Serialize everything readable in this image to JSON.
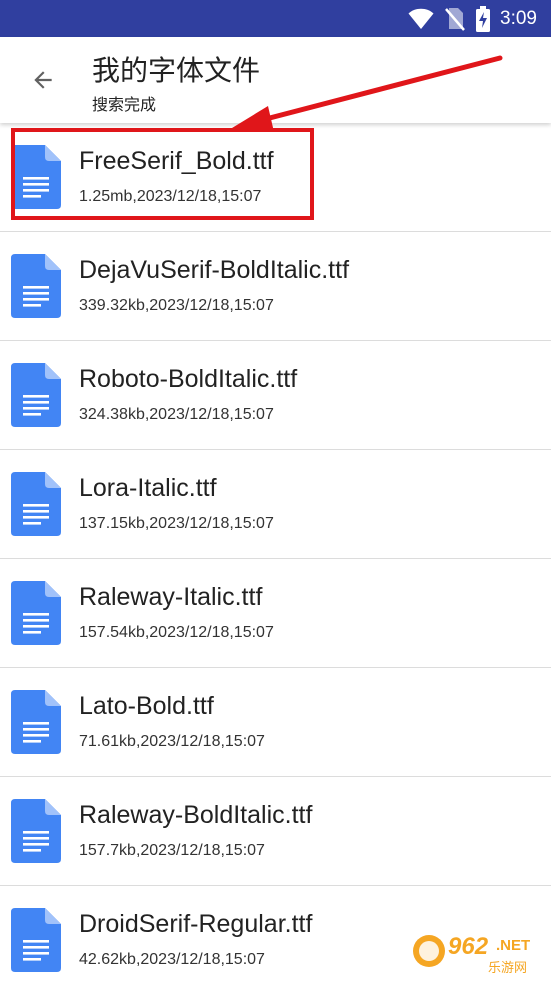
{
  "status_bar": {
    "time": "3:09",
    "bg_color": "#303f9f",
    "icons": [
      "wifi-icon",
      "no-sim-icon",
      "battery-charging-icon"
    ]
  },
  "app_bar": {
    "back_icon": "arrow-back-icon",
    "title": "我的字体文件",
    "subtitle": "搜索完成"
  },
  "files": [
    {
      "name": "FreeSerif_Bold.ttf",
      "meta": "1.25mb,2023/12/18,15:07"
    },
    {
      "name": "DejaVuSerif-BoldItalic.ttf",
      "meta": "339.32kb,2023/12/18,15:07"
    },
    {
      "name": "Roboto-BoldItalic.ttf",
      "meta": "324.38kb,2023/12/18,15:07"
    },
    {
      "name": "Lora-Italic.ttf",
      "meta": "137.15kb,2023/12/18,15:07"
    },
    {
      "name": "Raleway-Italic.ttf",
      "meta": "157.54kb,2023/12/18,15:07"
    },
    {
      "name": "Lato-Bold.ttf",
      "meta": "71.61kb,2023/12/18,15:07"
    },
    {
      "name": "Raleway-BoldItalic.ttf",
      "meta": "157.7kb,2023/12/18,15:07"
    },
    {
      "name": "DroidSerif-Regular.ttf",
      "meta": "42.62kb,2023/12/18,15:07"
    }
  ],
  "file_icon": "document-icon",
  "file_icon_color": "#4285f4",
  "annotation": {
    "highlight_color": "#e0161a",
    "highlighted_item_index": 0
  },
  "watermark": {
    "text_top": "962",
    "text_suffix": ".NET",
    "text_bottom": "乐游网"
  }
}
